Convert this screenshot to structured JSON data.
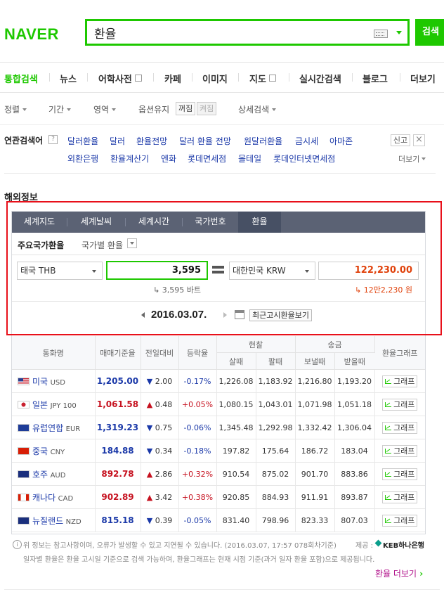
{
  "header": {
    "logo": "NAVER",
    "query": "환율",
    "search_button": "검색"
  },
  "tabs": [
    {
      "label": "통합검색",
      "active": true
    },
    {
      "label": "뉴스"
    },
    {
      "label": "어학사전",
      "external": true
    },
    {
      "label": "카페"
    },
    {
      "label": "이미지"
    },
    {
      "label": "지도",
      "external": true
    },
    {
      "label": "실시간검색"
    },
    {
      "label": "블로그"
    },
    {
      "label": "더보기"
    }
  ],
  "options": {
    "sort": "정렬",
    "period": "기간",
    "area": "영역",
    "keep_option": "옵션유지",
    "on": "꺼짐",
    "off": "켜짐",
    "detail": "상세검색"
  },
  "related": {
    "title": "연관검색어",
    "help": "?",
    "row1": [
      "달러환율",
      "달러",
      "환율전망",
      "달러 환율 전망",
      "원달러환율",
      "금시세",
      "아마존"
    ],
    "row2": [
      "외환은행",
      "환율계산기",
      "엔화",
      "롯데면세점",
      "몰테일",
      "롯데인터넷면세점"
    ],
    "report": "신고",
    "close": "×",
    "more": "더보기"
  },
  "section_title": "해외정보",
  "widget": {
    "tabs": [
      "세계지도",
      "세계날씨",
      "세계시간",
      "국가번호",
      "환율"
    ],
    "sub_tab_main": "주요국가환율",
    "sub_tab_country": "국가별 환율",
    "from_currency": "태국 THB",
    "from_amount": "3,595",
    "to_currency": "대한민국 KRW",
    "to_amount": "122,230.00",
    "from_hint": "3,595 바트",
    "to_hint": "12만2,230 원",
    "date": "2016.03.07.",
    "latest_button": "최근고시환율보기"
  },
  "table": {
    "headers": {
      "name": "통화명",
      "base": "매매기준율",
      "change": "전일대비",
      "rate": "등락율",
      "cash": "현찰",
      "remit": "송금",
      "graph": "환율그래프",
      "buy": "살때",
      "sell": "팔때",
      "send": "보낼때",
      "receive": "받을때"
    },
    "graph_label": "그래프",
    "rows": [
      {
        "name": "미국",
        "code": "USD",
        "flag": "us",
        "base": "1,205.00",
        "dir": "down",
        "arrow": "▼",
        "change": "2.00",
        "pct": "-0.17%",
        "cash_buy": "1,226.08",
        "cash_sell": "1,183.92",
        "send": "1,216.80",
        "receive": "1,193.20"
      },
      {
        "name": "일본",
        "code": "JPY 100",
        "flag": "jp",
        "base": "1,061.58",
        "dir": "up",
        "arrow": "▲",
        "change": "0.48",
        "pct": "+0.05%",
        "cash_buy": "1,080.15",
        "cash_sell": "1,043.01",
        "send": "1,071.98",
        "receive": "1,051.18"
      },
      {
        "name": "유럽연합",
        "code": "EUR",
        "flag": "eu",
        "base": "1,319.23",
        "dir": "down",
        "arrow": "▼",
        "change": "0.75",
        "pct": "-0.06%",
        "cash_buy": "1,345.48",
        "cash_sell": "1,292.98",
        "send": "1,332.42",
        "receive": "1,306.04"
      },
      {
        "name": "중국",
        "code": "CNY",
        "flag": "cn",
        "base": "184.88",
        "dir": "down",
        "arrow": "▼",
        "change": "0.34",
        "pct": "-0.18%",
        "cash_buy": "197.82",
        "cash_sell": "175.64",
        "send": "186.72",
        "receive": "183.04"
      },
      {
        "name": "호주",
        "code": "AUD",
        "flag": "au",
        "base": "892.78",
        "dir": "up",
        "arrow": "▲",
        "change": "2.86",
        "pct": "+0.32%",
        "cash_buy": "910.54",
        "cash_sell": "875.02",
        "send": "901.70",
        "receive": "883.86"
      },
      {
        "name": "캐나다",
        "code": "CAD",
        "flag": "ca",
        "base": "902.89",
        "dir": "up",
        "arrow": "▲",
        "change": "3.42",
        "pct": "+0.38%",
        "cash_buy": "920.85",
        "cash_sell": "884.93",
        "send": "911.91",
        "receive": "893.87"
      },
      {
        "name": "뉴질랜드",
        "code": "NZD",
        "flag": "nz",
        "base": "815.18",
        "dir": "down",
        "arrow": "▼",
        "change": "0.39",
        "pct": "-0.05%",
        "cash_buy": "831.40",
        "cash_sell": "798.96",
        "send": "823.33",
        "receive": "807.03"
      }
    ]
  },
  "footnote": {
    "line1": "위 정보는 참고사항이며, 오류가 발생할 수 있고 지연될 수 있습니다. (2016.03.07, 17:57 078회차기준)",
    "provider_label": "제공 :",
    "provider": "KEB하나은행",
    "line2": "일자별 환율은 환율 고시일 기준으로 검색 가능하며, 환율그래프는 현재 시점 기준(과거 일자 환율 포함)으로 제공됩니다.",
    "more": "환율 더보기"
  },
  "colors": {
    "brand": "#1ec800",
    "highlight_box": "#e8101a",
    "down": "#1a38a8",
    "up": "#c6111f"
  }
}
